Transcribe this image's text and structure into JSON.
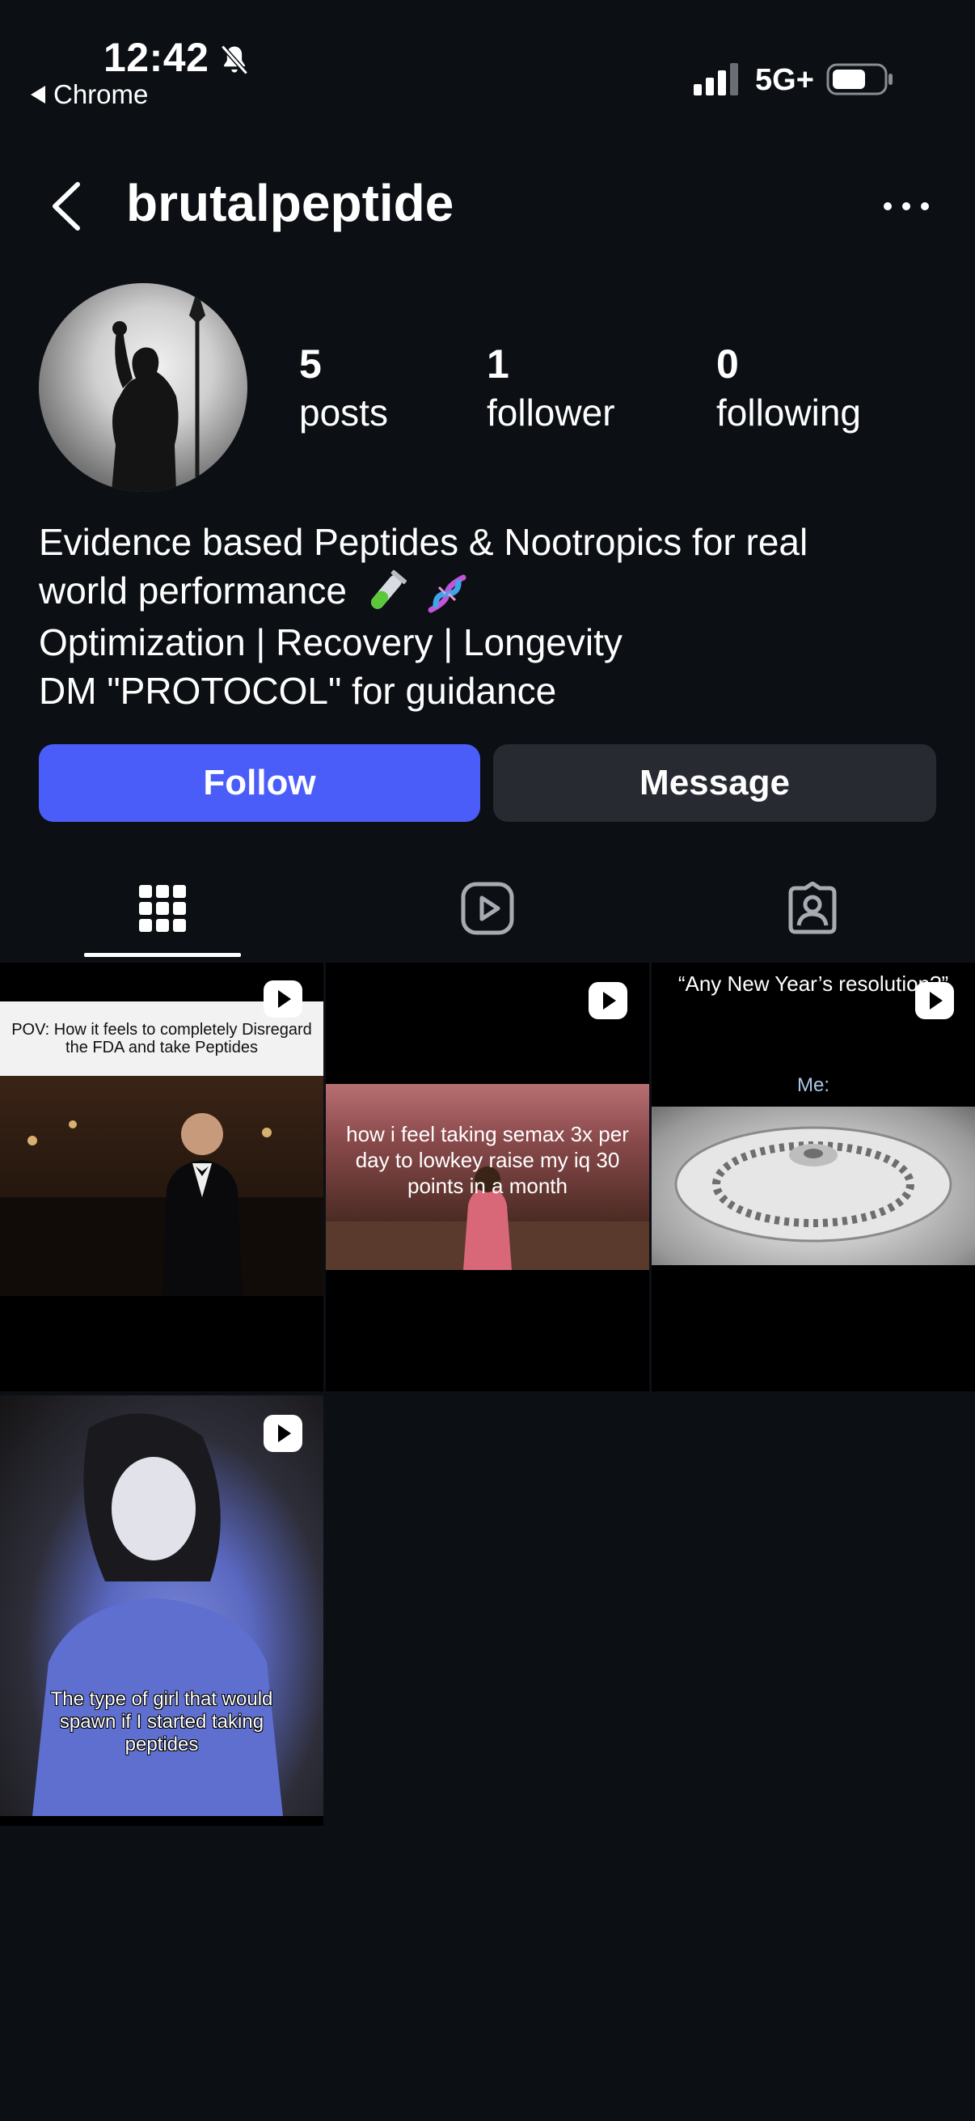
{
  "status_bar": {
    "time": "12:42",
    "back_app": "Chrome",
    "network": "5G+"
  },
  "header": {
    "username": "brutalpeptide"
  },
  "stats": [
    {
      "count": "5",
      "label": "posts"
    },
    {
      "count": "1",
      "label": "follower"
    },
    {
      "count": "0",
      "label": "following"
    }
  ],
  "bio": {
    "line1": "Evidence based Peptides & Nootropics for real",
    "line2": "world performance",
    "line3": "Optimization | Recovery | Longevity",
    "line4": "DM \"PROTOCOL\" for guidance"
  },
  "actions": {
    "follow": "Follow",
    "message": "Message"
  },
  "tabs": [
    {
      "icon": "grid-icon",
      "active": true
    },
    {
      "icon": "reels-icon",
      "active": false
    },
    {
      "icon": "tagged-icon",
      "active": false
    }
  ],
  "posts": [
    {
      "caption": "POV: How it feels to completely Disregard the FDA and take Peptides"
    },
    {
      "caption": "how i feel taking semax 3x per day to lowkey raise my iq 30 points in a month"
    },
    {
      "caption": "“Any New Year’s resolution?”",
      "sub": "Me:"
    },
    {
      "caption": "The type of girl that would spawn if I started taking peptides"
    }
  ],
  "colors": {
    "background": "#0c0f14",
    "follow_button": "#4a5df9",
    "message_button": "#272a31"
  }
}
